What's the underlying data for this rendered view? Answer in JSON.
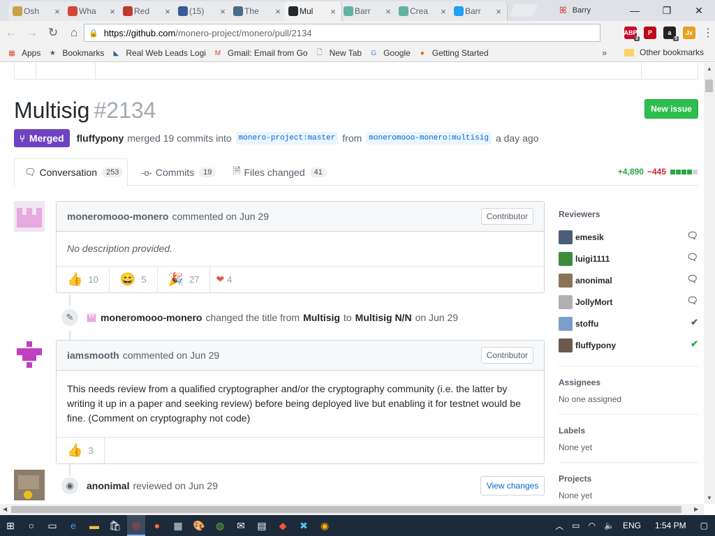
{
  "browser": {
    "tabs": [
      {
        "title": "Osh",
        "icon": "oshi-icon",
        "color": "#c8a24a",
        "active": false
      },
      {
        "title": "Wha",
        "icon": "gmail-icon",
        "color": "#d44638",
        "active": false
      },
      {
        "title": "Red",
        "icon": "reddit-icon",
        "color": "#c0392b",
        "active": false
      },
      {
        "title": "(15)",
        "icon": "facebook-icon",
        "color": "#3b5998",
        "active": false
      },
      {
        "title": "The",
        "icon": "bitcoin-icon",
        "color": "#4a6b8a",
        "active": false
      },
      {
        "title": "Mul",
        "icon": "github-icon",
        "color": "#24292e",
        "active": true
      },
      {
        "title": "Barr",
        "icon": "circle-icon",
        "color": "#5fb3a1",
        "active": false
      },
      {
        "title": "Crea",
        "icon": "circle-icon",
        "color": "#5fb3a1",
        "active": false
      },
      {
        "title": "Barr",
        "icon": "twitter-icon",
        "color": "#1da1f2",
        "active": false
      }
    ],
    "profile_name": "Barry",
    "url_host": "https://github.com",
    "url_path": "/monero-project/monero/pull/2134",
    "extensions": [
      {
        "label": "ABP",
        "color": "#c70d2c",
        "count": "3"
      },
      {
        "label": "P",
        "color": "#bd081c",
        "count": ""
      },
      {
        "label": "a",
        "color": "#222222",
        "count": "5"
      },
      {
        "label": "Jx",
        "color": "#e8a020",
        "count": ""
      }
    ],
    "bookmarks": [
      {
        "label": "Apps",
        "icon": "apps-icon"
      },
      {
        "label": "Bookmarks",
        "icon": "star-icon"
      },
      {
        "label": "Real Web Leads Logi",
        "icon": "leads-icon"
      },
      {
        "label": "Gmail: Email from Go",
        "icon": "gmail-icon"
      },
      {
        "label": "New Tab",
        "icon": "page-icon"
      },
      {
        "label": "Google",
        "icon": "google-icon"
      },
      {
        "label": "Getting Started",
        "icon": "firefox-icon"
      }
    ],
    "bookmarks_more": "»",
    "other_bookmarks": "Other bookmarks"
  },
  "pr": {
    "title": "Multisig",
    "number": "#2134",
    "new_issue": "New issue",
    "state": "Merged",
    "author": "fluffypony",
    "merge_text": "merged 19 commits into",
    "base_branch": "monero-project:master",
    "from_text": "from",
    "head_branch": "moneromooo-monero:multisig",
    "when": "a day ago",
    "tabs": [
      {
        "label": "Conversation",
        "count": "253"
      },
      {
        "label": "Commits",
        "count": "19"
      },
      {
        "label": "Files changed",
        "count": "41"
      }
    ],
    "additions": "+4,890",
    "deletions": "−445",
    "diff_blocks": [
      "#28a745",
      "#28a745",
      "#28a745",
      "#28a745",
      "#d1d5da"
    ]
  },
  "timeline": {
    "comment1": {
      "author": "moneromooo-monero",
      "action": "commented on Jun 29",
      "badge": "Contributor",
      "body": "No description provided.",
      "reactions": [
        {
          "emoji": "👍",
          "count": "10"
        },
        {
          "emoji": "😄",
          "count": "5"
        },
        {
          "emoji": "🎉",
          "count": "27"
        },
        {
          "emoji": "❤",
          "count": "4"
        }
      ]
    },
    "rename": {
      "author": "moneromooo-monero",
      "text1": "changed the title from",
      "from": "Multisig",
      "to_word": "to",
      "to": "Multisig N/N",
      "date": "on Jun 29"
    },
    "comment2": {
      "author": "iamsmooth",
      "action": "commented on Jun 29",
      "badge": "Contributor",
      "body": "This needs review from a qualified cryptographer and/or the cryptography community (i.e. the latter by writing it up in a paper and seeking review) before being deployed live but enabling it for testnet would be fine. (Comment on cryptography not code)",
      "reactions": [
        {
          "emoji": "👍",
          "count": "3"
        }
      ]
    },
    "review": {
      "author": "anonimal",
      "action": "reviewed on Jun 29",
      "button": "View changes"
    }
  },
  "sidebar": {
    "reviewers_title": "Reviewers",
    "reviewers": [
      {
        "name": "emesik",
        "status": "comment",
        "color": "#4a5d7a"
      },
      {
        "name": "luigi1111",
        "status": "comment",
        "color": "#3d8b3d"
      },
      {
        "name": "anonimal",
        "status": "comment",
        "color": "#8b7355"
      },
      {
        "name": "JollyMort",
        "status": "comment",
        "color": "#b0b0b0"
      },
      {
        "name": "stoffu",
        "status": "approved-gray",
        "color": "#7a9fc8"
      },
      {
        "name": "fluffypony",
        "status": "approved",
        "color": "#6b5a4a"
      }
    ],
    "assignees_title": "Assignees",
    "assignees_value": "No one assigned",
    "labels_title": "Labels",
    "labels_value": "None yet",
    "projects_title": "Projects",
    "projects_value": "None yet"
  },
  "taskbar": {
    "lang": "ENG",
    "time": "1:54 PM"
  }
}
